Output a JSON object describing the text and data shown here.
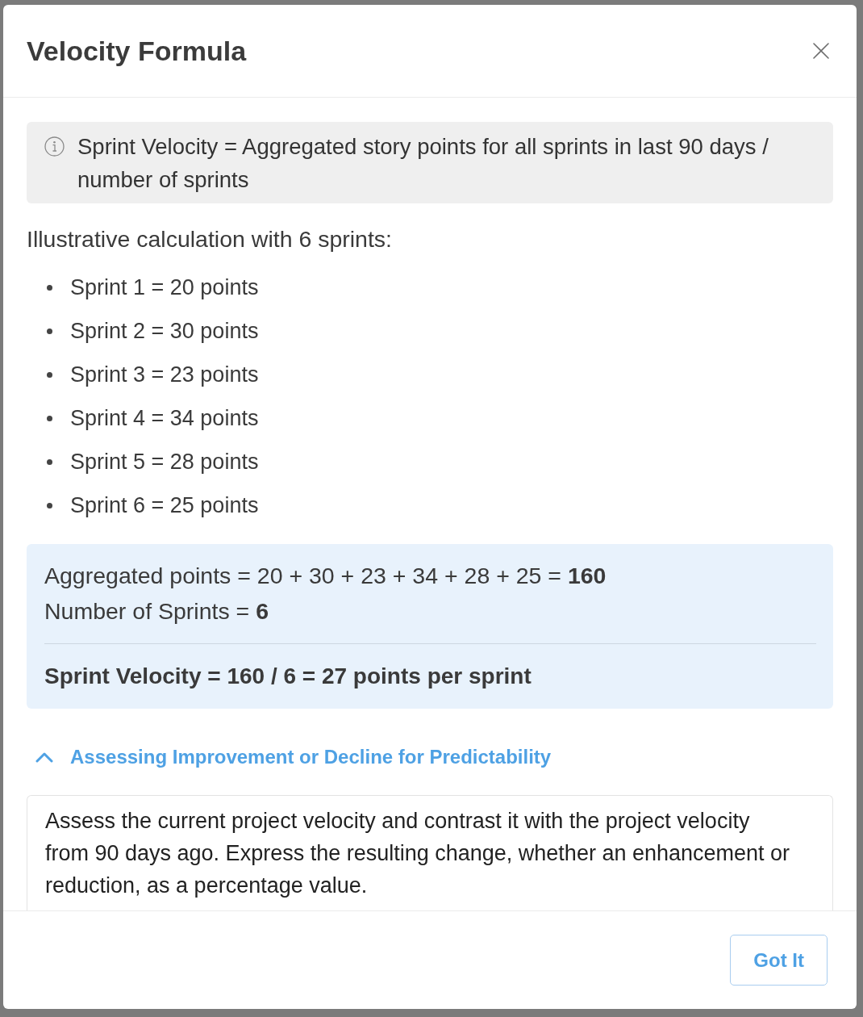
{
  "dialog": {
    "title": "Velocity Formula",
    "formula_note": "Sprint Velocity = Aggregated story points for all sprints in last 90 days / number of sprints",
    "example_intro": "Illustrative calculation with 6 sprints:",
    "sprints": [
      "Sprint 1 = 20 points",
      "Sprint 2 = 30 points",
      "Sprint 3 = 23 points",
      "Sprint 4 = 34 points",
      "Sprint 5 = 28 points",
      "Sprint 6 = 25 points"
    ],
    "calculation": {
      "lines": [
        "Aggregated points = 20 + 30 + 23 + 34 + 28 + 25 = **160**",
        "Number of Sprints = **6**"
      ],
      "result": "Sprint Velocity = 160 / 6 = 27 points per sprint"
    },
    "section": {
      "title": "Assessing Improvement or Decline for Predictability",
      "expanded": true,
      "text": "Assess the current project velocity and contrast it with the project velocity from 90 days ago. Express the resulting change, whether an enhancement or reduction, as a percentage value."
    },
    "buttons": [
      "Got It"
    ]
  }
}
